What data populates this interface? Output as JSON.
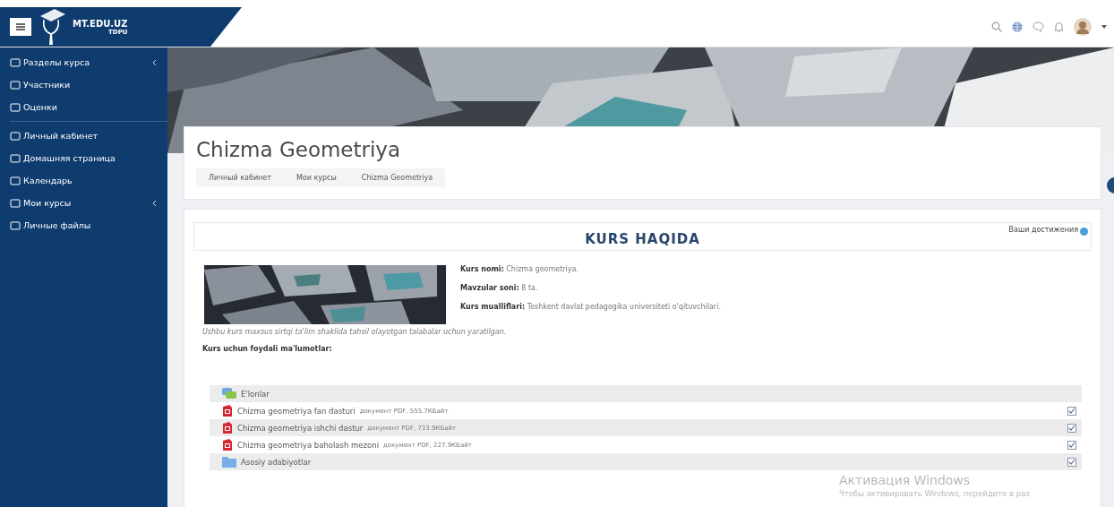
{
  "navbar": {
    "logo_title": "MT.EDU.UZ",
    "logo_subtitle": "TDPU"
  },
  "sidebar": {
    "groups": [
      [
        {
          "label": "Разделы курса",
          "has_submenu": true
        },
        {
          "label": "Участники",
          "has_submenu": false
        },
        {
          "label": "Оценки",
          "has_submenu": false
        }
      ],
      [
        {
          "label": "Личный кабинет",
          "has_submenu": false
        },
        {
          "label": "Домашняя страница",
          "has_submenu": false
        },
        {
          "label": "Календарь",
          "has_submenu": false
        },
        {
          "label": "Мои курсы",
          "has_submenu": true
        },
        {
          "label": "Личные файлы",
          "has_submenu": false
        }
      ]
    ]
  },
  "page_header": {
    "title": "Chizma Geometriya",
    "breadcrumb": [
      "Личный кабинет",
      "Мои курсы",
      "Chizma Geometriya"
    ]
  },
  "course": {
    "heading": "KURS HAQIDA",
    "achievements": "Ваши достижения",
    "info": [
      {
        "label": "Kurs nomi:",
        "value": "Chizma geometriya."
      },
      {
        "label": "Mavzular soni:",
        "value": "8 ta."
      },
      {
        "label": "Kurs mualliflari:",
        "value": "Toshkent davlat pedagogika universiteti o'qituvchilari."
      }
    ],
    "description": "Ushbu kurs maxsus sirtqi ta'lim shaklida tahsil olayotgan talabalar uchun yaratilgan.",
    "useful_heading": "Kurs uchun foydali ma'lumotlar:",
    "activities": [
      {
        "kind": "forum",
        "name": "E'lonlar"
      },
      {
        "kind": "pdf",
        "name": "Chizma geometriya fan dasturi",
        "meta": "документ PDF, 555.7КБайт",
        "completed": true
      },
      {
        "kind": "pdf",
        "name": "Chizma geometriya ishchi dastur",
        "meta": "документ PDF, 733.9КБайт",
        "completed": true
      },
      {
        "kind": "pdf",
        "name": "Chizma geometriya baholash mezoni",
        "meta": "документ PDF, 227.9КБайт",
        "completed": true
      },
      {
        "kind": "folder",
        "name": "Asosiy adabiyotlar",
        "completed": true
      }
    ]
  },
  "os_overlay": {
    "title": "Активация Windows",
    "text": "Чтобы активировать Windows, перейдите в раз"
  }
}
